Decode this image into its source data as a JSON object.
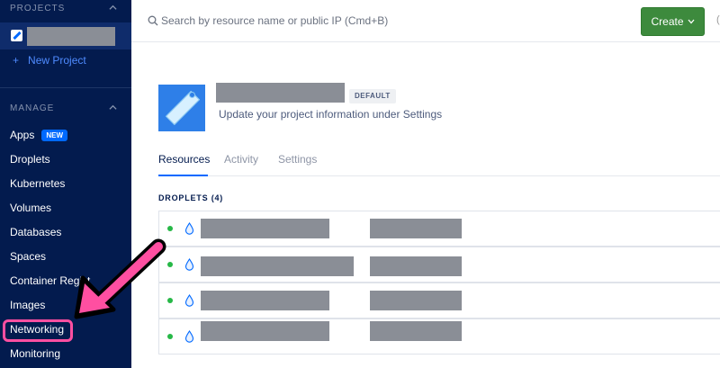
{
  "sidebar": {
    "projects_heading": "PROJECTS",
    "new_project_label": "New Project",
    "manage_heading": "MANAGE",
    "items": [
      {
        "label": "Apps",
        "badge": "NEW"
      },
      {
        "label": "Droplets"
      },
      {
        "label": "Kubernetes"
      },
      {
        "label": "Volumes"
      },
      {
        "label": "Databases"
      },
      {
        "label": "Spaces"
      },
      {
        "label": "Container Regist"
      },
      {
        "label": "Images"
      },
      {
        "label": "Networking"
      },
      {
        "label": "Monitoring"
      }
    ]
  },
  "topbar": {
    "search_placeholder": "Search by resource name or public IP (Cmd+B)",
    "create_label": "Create",
    "edge_letter": "("
  },
  "project": {
    "badge": "DEFAULT",
    "description": "Update your project information under Settings"
  },
  "tabs": [
    {
      "label": "Resources",
      "active": true
    },
    {
      "label": "Activity",
      "active": false
    },
    {
      "label": "Settings",
      "active": false
    }
  ],
  "droplets": {
    "heading": "DROPLETS (4)",
    "status_color": "#27b847"
  },
  "colors": {
    "sidebar_bg": "#031b4e",
    "accent": "#0069ff",
    "create_button": "#3d8a3d",
    "highlight": "#ff4fa1"
  }
}
